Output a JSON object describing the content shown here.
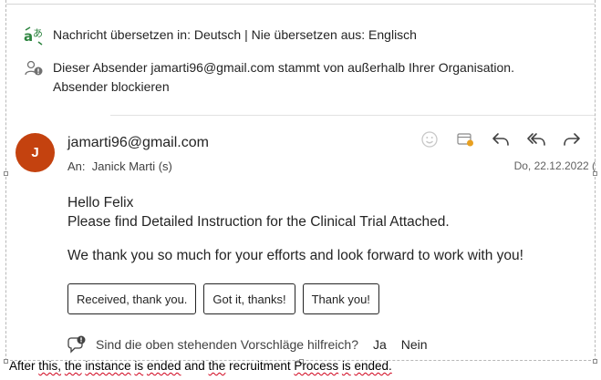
{
  "translation_bar": {
    "icon": "translate-icon",
    "prefix": "Nachricht übersetzen in: ",
    "translate_to": "Deutsch",
    "separator": " | ",
    "never_translate": "Nie übersetzen aus: Englisch"
  },
  "external_warning": {
    "icon": "external-people-icon",
    "text": "Dieser Absender jamarti96@gmail.com stammt von außerhalb Ihrer Organisation.",
    "block_link": "Absender blockieren"
  },
  "message": {
    "avatar_initial": "J",
    "avatar_color": "#c4420f",
    "sender": "jamarti96@gmail.com",
    "to_label": "An:",
    "to_value": "Janick Marti (s)",
    "date": "Do, 22.12.2022 (",
    "actions": [
      "emoji-react-icon",
      "calendar-icon",
      "reply-icon",
      "reply-all-icon",
      "forward-icon"
    ],
    "body": {
      "line1": "Hello Felix",
      "line2": "Please find Detailed Instruction for the Clinical Trial Attached.",
      "line3": "We thank you so much for your efforts and look forward to work with you!"
    }
  },
  "suggested_replies": [
    "Received, thank you.",
    "Got it, thanks!",
    "Thank you!"
  ],
  "feedback": {
    "icon": "feedback-icon",
    "question": "Sind die oben stehenden Vorschläge hilfreich?",
    "yes": "Ja",
    "no": "Nein"
  },
  "caption": {
    "w1": "After",
    "w2": "this,",
    "w3": "the",
    "w4": "instance",
    "w5": "is",
    "w6": "ended",
    "w7": "and",
    "w8": "the",
    "w9": "recruitment",
    "w10": "Process",
    "w11": "is",
    "w12": "ended."
  }
}
